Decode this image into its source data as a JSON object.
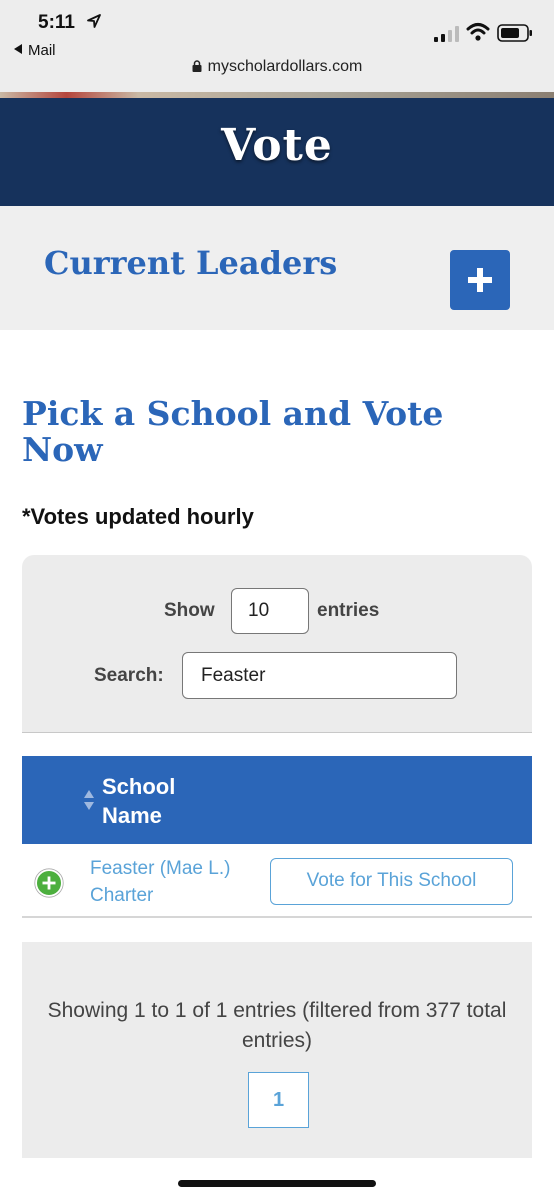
{
  "status_bar": {
    "time": "5:11",
    "back_app": "Mail",
    "url": "myscholardollars.com"
  },
  "header": {
    "title": "Vote"
  },
  "leaders": {
    "title": "Current Leaders",
    "expand_icon": "plus-icon"
  },
  "main": {
    "heading": "Pick a School and Vote Now",
    "note": "*Votes updated hourly"
  },
  "controls": {
    "show_label": "Show",
    "show_value": "10",
    "entries_label": "entries",
    "search_label": "Search:",
    "search_value": "Feaster"
  },
  "table": {
    "columns": [
      "School Name"
    ],
    "rows": [
      {
        "school": "Feaster (Mae L.) Charter",
        "action": "Vote for This School"
      }
    ]
  },
  "pagination": {
    "info": "Showing 1 to 1 of 1 entries (filtered from 377 total entries)",
    "pages": [
      "1"
    ]
  },
  "colors": {
    "header_navy": "#16325c",
    "brand_blue": "#2b66b8",
    "link_blue": "#5aa3d8",
    "expand_green": "#4caf3e"
  }
}
